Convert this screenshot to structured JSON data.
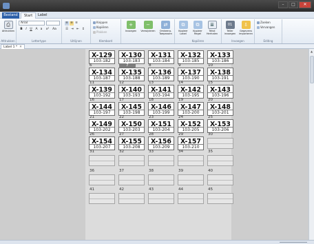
{
  "window": {
    "title": "",
    "buttons": [
      "–",
      "□",
      "✕"
    ]
  },
  "ribbon_tabs": {
    "file": "Bestand",
    "tabs": [
      "Start",
      "Label"
    ]
  },
  "ribbon": {
    "groups": [
      {
        "label": "Afdrukken",
        "button": "Afdrukken",
        "icon": "printer-icon"
      },
      {
        "label": "Lettertype",
        "font": "Arial",
        "size": "",
        "bold": "B",
        "italic": "I",
        "underline": "U"
      },
      {
        "label": "Uitlijnen"
      },
      {
        "label": "Klembord",
        "items": [
          "Knippen",
          "Kopiëren",
          "Plakken"
        ]
      },
      {
        "label": "",
        "buttons": [
          "Invoegen",
          "Verwijderen",
          "Omkeerp. Toepassen"
        ]
      },
      {
        "label": "Kopiëren",
        "buttons": [
          "Kopieer Label",
          "Kopieer Regel",
          "Tekst Herhalen"
        ]
      },
      {
        "label": "Invoegen",
        "buttons": [
          "Teller invoegen",
          "Gegevens importeren"
        ]
      },
      {
        "label": "Editing",
        "items": [
          "Zoeken",
          "Vervangen"
        ]
      }
    ]
  },
  "document": {
    "tab_label": "Label 1 *",
    "selected_cell": 7
  },
  "labels": [
    {
      "n": "1",
      "code": "X-129",
      "sub": "103-182"
    },
    {
      "n": "2",
      "code": "X-130",
      "sub": "103-183"
    },
    {
      "n": "3",
      "code": "X-131",
      "sub": "103-184"
    },
    {
      "n": "4",
      "code": "X-132",
      "sub": "103-185"
    },
    {
      "n": "5",
      "code": "X-133",
      "sub": "103-186"
    },
    {
      "n": "6",
      "code": "X-134",
      "sub": "103-187"
    },
    {
      "n": "7",
      "code": "X-135",
      "sub": "103-188"
    },
    {
      "n": "8",
      "code": "X-136",
      "sub": "103-189"
    },
    {
      "n": "9",
      "code": "X-137",
      "sub": "103-190"
    },
    {
      "n": "10",
      "code": "X-138",
      "sub": "103-191"
    },
    {
      "n": "11",
      "code": "X-139",
      "sub": "103-192"
    },
    {
      "n": "12",
      "code": "X-140",
      "sub": "103-193"
    },
    {
      "n": "13",
      "code": "X-141",
      "sub": "103-194"
    },
    {
      "n": "14",
      "code": "X-142",
      "sub": "103-195"
    },
    {
      "n": "15",
      "code": "X-143",
      "sub": "103-196"
    },
    {
      "n": "16",
      "code": "X-144",
      "sub": "103-197"
    },
    {
      "n": "17",
      "code": "X-145",
      "sub": "103-198"
    },
    {
      "n": "18",
      "code": "X-146",
      "sub": "103-199"
    },
    {
      "n": "19",
      "code": "X-147",
      "sub": "103-200"
    },
    {
      "n": "20",
      "code": "X-148",
      "sub": "103-201"
    },
    {
      "n": "21",
      "code": "X-149",
      "sub": "103-202"
    },
    {
      "n": "22",
      "code": "X-150",
      "sub": "103-203"
    },
    {
      "n": "23",
      "code": "X-151",
      "sub": "103-204"
    },
    {
      "n": "24",
      "code": "X-152",
      "sub": "103-205"
    },
    {
      "n": "25",
      "code": "X-153",
      "sub": "103-206"
    },
    {
      "n": "26",
      "code": "X-154",
      "sub": "103-207"
    },
    {
      "n": "27",
      "code": "X-155",
      "sub": "103-208"
    },
    {
      "n": "28",
      "code": "X-156",
      "sub": "103-209"
    },
    {
      "n": "29",
      "code": "X-157",
      "sub": "103-210"
    },
    {
      "n": "30",
      "code": "",
      "sub": ""
    },
    {
      "n": "31",
      "code": "",
      "sub": ""
    },
    {
      "n": "32",
      "code": "",
      "sub": ""
    },
    {
      "n": "33",
      "code": "",
      "sub": ""
    },
    {
      "n": "34",
      "code": "",
      "sub": ""
    },
    {
      "n": "35",
      "code": "",
      "sub": ""
    },
    {
      "n": "36",
      "code": "",
      "sub": ""
    },
    {
      "n": "37",
      "code": "",
      "sub": ""
    },
    {
      "n": "38",
      "code": "",
      "sub": ""
    },
    {
      "n": "39",
      "code": "",
      "sub": ""
    },
    {
      "n": "40",
      "code": "",
      "sub": ""
    },
    {
      "n": "41",
      "code": "",
      "sub": ""
    },
    {
      "n": "42",
      "code": "",
      "sub": ""
    },
    {
      "n": "43",
      "code": "",
      "sub": ""
    },
    {
      "n": "44",
      "code": "",
      "sub": ""
    },
    {
      "n": "45",
      "code": "",
      "sub": ""
    }
  ]
}
